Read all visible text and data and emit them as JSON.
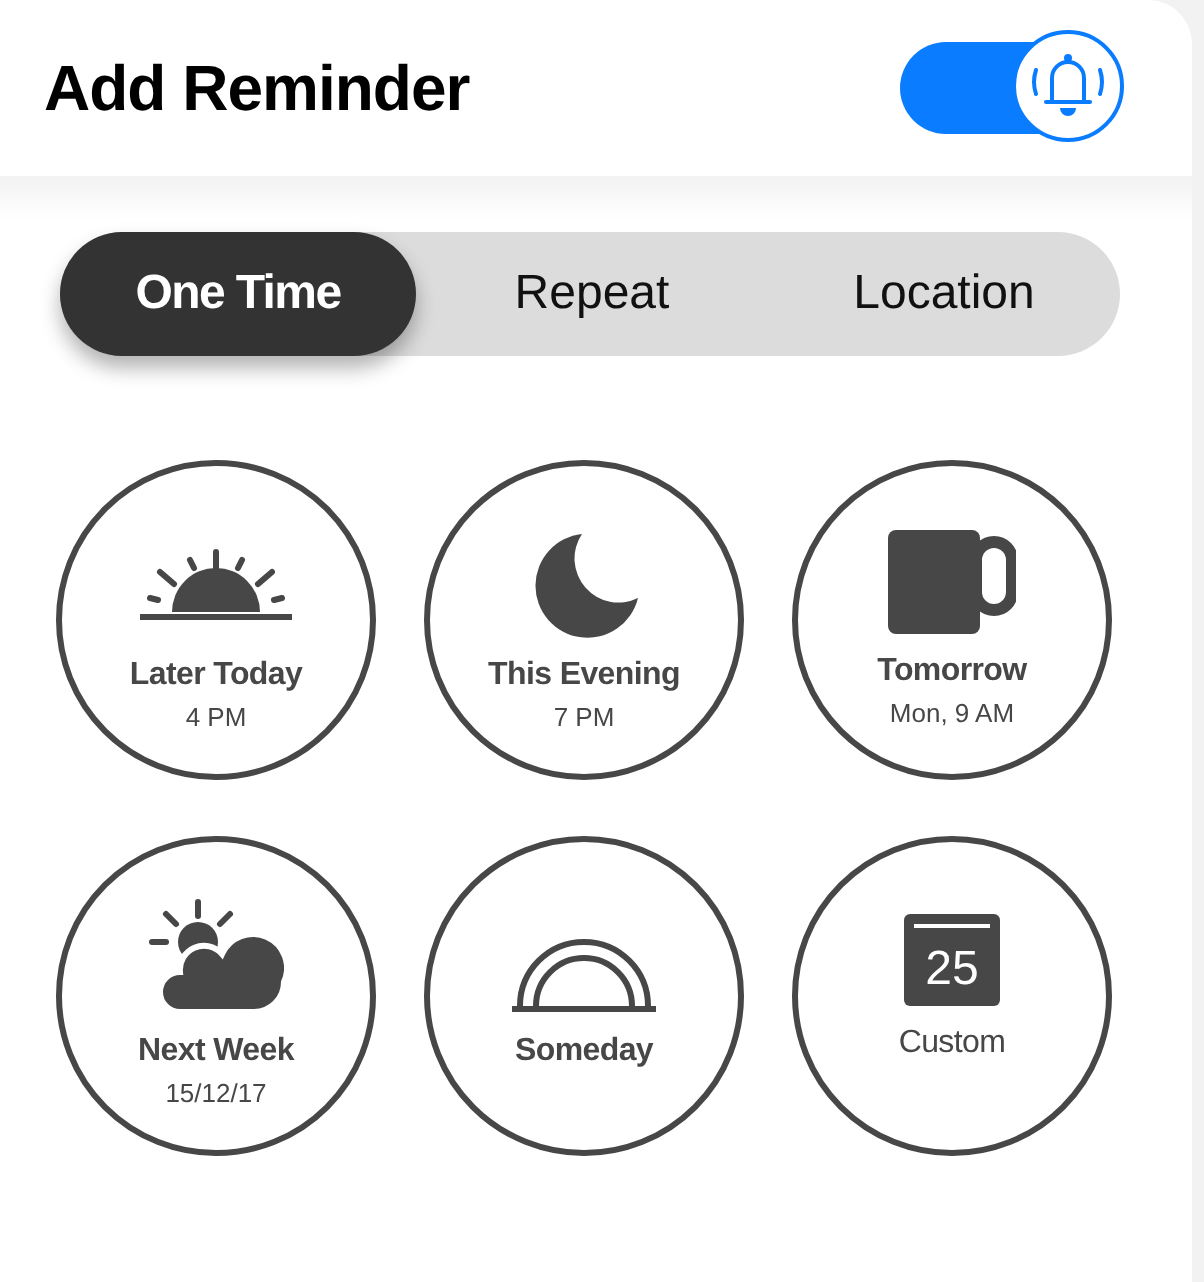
{
  "header": {
    "title": "Add Reminder",
    "alert_toggle": {
      "on": true
    }
  },
  "tabs": [
    {
      "label": "One Time",
      "selected": true
    },
    {
      "label": "Repeat",
      "selected": false
    },
    {
      "label": "Location",
      "selected": false
    }
  ],
  "options": [
    {
      "kind": "sunrise",
      "label": "Later Today",
      "detail": "4 PM"
    },
    {
      "kind": "moon",
      "label": "This Evening",
      "detail": "7 PM"
    },
    {
      "kind": "mug",
      "label": "Tomorrow",
      "detail": "Mon, 9 AM"
    },
    {
      "kind": "sun-cloud",
      "label": "Next Week",
      "detail": "15/12/17"
    },
    {
      "kind": "rainbow",
      "label": "Someday"
    },
    {
      "kind": "calendar",
      "label": "Custom",
      "icon_text": "25"
    }
  ]
}
